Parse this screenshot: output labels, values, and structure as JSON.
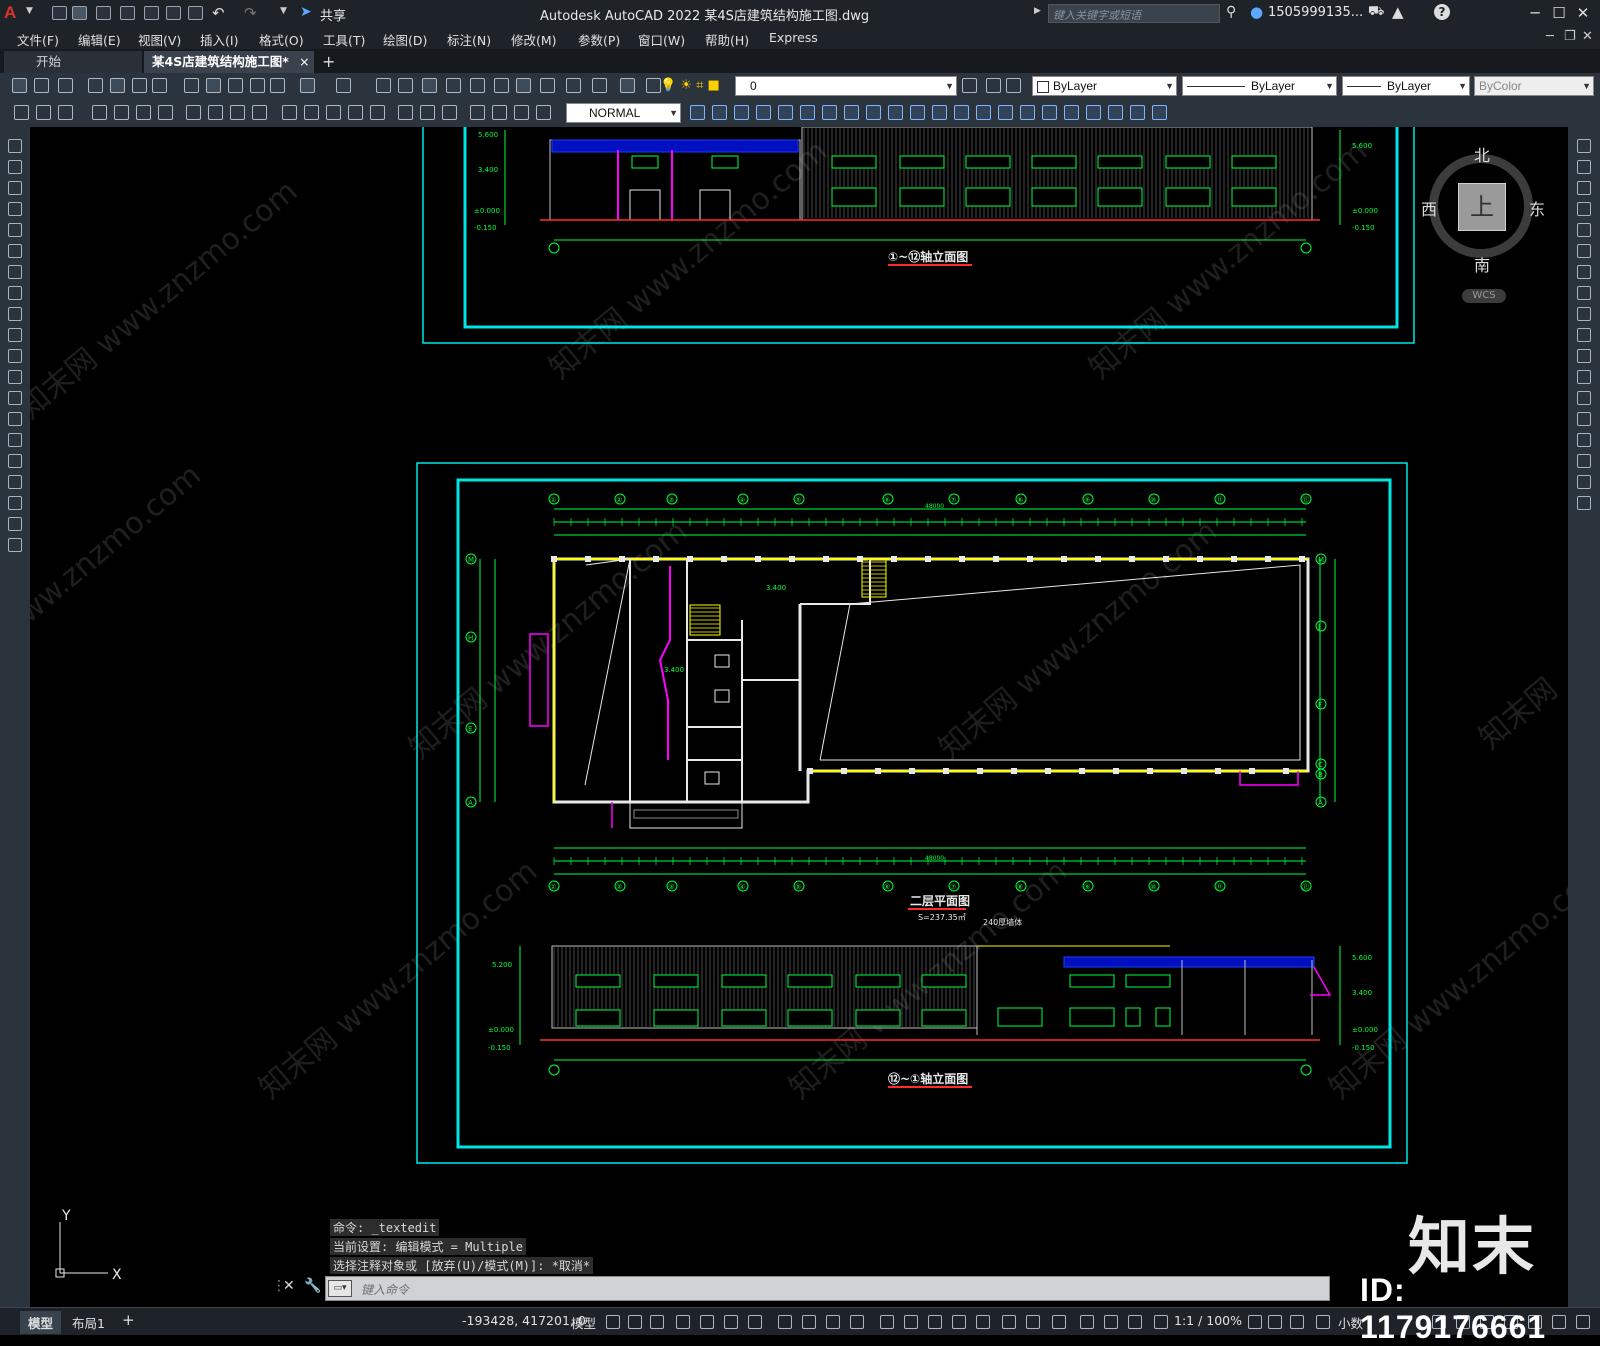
{
  "app": {
    "title": "Autodesk AutoCAD 2022    某4S店建筑结构施工图.dwg",
    "share_label": "共享",
    "search_placeholder": "键入关键字或短语",
    "user": "1505999135...",
    "logo_letter": "A"
  },
  "menu": [
    "文件(F)",
    "编辑(E)",
    "视图(V)",
    "插入(I)",
    "格式(O)",
    "工具(T)",
    "绘图(D)",
    "标注(N)",
    "修改(M)",
    "参数(P)",
    "窗口(W)",
    "帮助(H)",
    "Express"
  ],
  "tabs": {
    "start": "开始",
    "drawing": "某4S店建筑结构施工图*",
    "close": "×",
    "add": "+"
  },
  "toolbar": {
    "layer_value": "0",
    "color": "ByLayer",
    "linetype": "ByLayer",
    "lineweight": "ByLayer",
    "plotstyle": "ByColor",
    "textstyle": "NORMAL"
  },
  "viewcube": {
    "north": "北",
    "south": "南",
    "east": "东",
    "west": "西",
    "face": "上",
    "wcs": "WCS"
  },
  "drawing": {
    "elevation_top_title": "①~⑫轴立面图",
    "plan_title": "二层平面图",
    "plan_area": "S=237.35㎡",
    "elevation_bottom_title": "⑫~①轴立面图",
    "note_wall": "240厚墙体",
    "dim_total": "48000",
    "level_top": "5.600",
    "level_mid": "3.400",
    "level_zero": "±0.000",
    "level_neg": "-0.150",
    "level_3400": "3.400",
    "level_5200": "5.200",
    "axes_top": [
      "①",
      "②",
      "③",
      "④",
      "⑤",
      "⑥",
      "⑦",
      "⑧",
      "⑨",
      "⑩",
      "⑪",
      "⑫"
    ],
    "axes_left": [
      "M",
      "H",
      "E",
      "A"
    ],
    "axes_right": [
      "M",
      "J",
      "F",
      "C",
      "B",
      "A"
    ]
  },
  "command": {
    "history": [
      "命令: _textedit",
      "当前设置: 编辑模式 = Multiple",
      "选择注释对象或 [放弃(U)/模式(M)]: *取消*"
    ],
    "placeholder": "键入命令"
  },
  "ucs": {
    "x": "X",
    "y": "Y"
  },
  "status": {
    "model_tab": "模型",
    "layout_tab": "布局1",
    "add": "+",
    "coords": "-193428, 417201, 0",
    "mode": "模型",
    "scale": "1:1 / 100%",
    "units": "小数"
  },
  "watermark": {
    "logo": "知末",
    "id": "ID: 1179176661"
  },
  "colors": {
    "frame": "#00e5e5",
    "dim": "#00ff3c",
    "wall": "#e8e8e8",
    "yellow": "#ffff00",
    "magenta": "#ff00ff",
    "red": "#ff2a2a"
  }
}
